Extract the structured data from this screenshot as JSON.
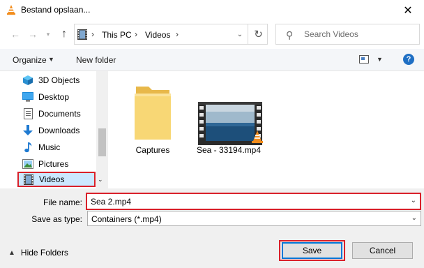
{
  "window": {
    "title": "Bestand opslaan..."
  },
  "nav": {
    "breadcrumb": [
      "This PC",
      "Videos"
    ]
  },
  "search": {
    "placeholder": "Search Videos"
  },
  "toolbar": {
    "organize_label": "Organize",
    "new_folder_label": "New folder"
  },
  "sidebar": {
    "items": [
      {
        "label": "3D Objects",
        "icon": "3d-objects-icon",
        "selected": false
      },
      {
        "label": "Desktop",
        "icon": "desktop-icon",
        "selected": false
      },
      {
        "label": "Documents",
        "icon": "documents-icon",
        "selected": false
      },
      {
        "label": "Downloads",
        "icon": "downloads-icon",
        "selected": false
      },
      {
        "label": "Music",
        "icon": "music-icon",
        "selected": false
      },
      {
        "label": "Pictures",
        "icon": "pictures-icon",
        "selected": false
      },
      {
        "label": "Videos",
        "icon": "videos-icon",
        "selected": true
      }
    ]
  },
  "files": [
    {
      "name": "Captures",
      "kind": "folder"
    },
    {
      "name": "Sea - 33194.mp4",
      "kind": "video"
    }
  ],
  "form": {
    "filename_label": "File name:",
    "filename_value": "Sea 2.mp4",
    "type_label": "Save as type:",
    "type_value": "Containers (*.mp4)"
  },
  "footer": {
    "hide_folders_label": "Hide Folders",
    "save_label": "Save",
    "cancel_label": "Cancel"
  },
  "colors": {
    "highlight_outline": "#d9202a",
    "selection_bg": "#cce8ff",
    "accent": "#0078d7"
  }
}
